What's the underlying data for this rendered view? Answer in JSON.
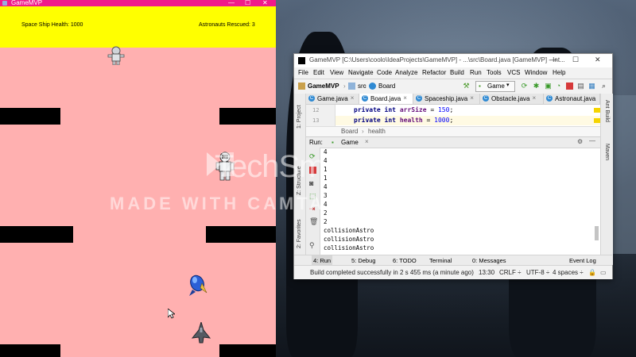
{
  "game_window": {
    "title": "GameMVP",
    "controls": {
      "minimize": "—",
      "maximize": "☐",
      "close": "✕"
    },
    "hud": {
      "health_text": "Space Ship Health: 1000",
      "rescued_text": "Astronauts Rescued: 3"
    },
    "colors": {
      "titlebar": "#f01a8a",
      "hud": "#ffff00",
      "background": "#ffb0b0"
    }
  },
  "ide": {
    "title": "GameMVP [C:\\Users\\coolo\\IdeaProjects\\GameMVP] - ...\\src\\Board.java [GameMVP] - Int...",
    "window_controls": {
      "minimize": "—",
      "maximize": "☐",
      "close": "✕"
    },
    "menu": [
      "File",
      "Edit",
      "View",
      "Navigate",
      "Code",
      "Analyze",
      "Refactor",
      "Build",
      "Run",
      "Tools",
      "VCS",
      "Window",
      "Help"
    ],
    "breadcrumb": {
      "project": "GameMVP",
      "folder": "src",
      "file": "Board"
    },
    "run_config": "Game",
    "left_tool_labels": {
      "project": "1: Project",
      "structure": "Z: Structure",
      "favorites": "2: Favorites"
    },
    "right_tool_labels": {
      "ant": "Ant Build",
      "maven": "Maven"
    },
    "editor_tabs": [
      {
        "label": "Game.java",
        "active": false
      },
      {
        "label": "Board.java",
        "active": true
      },
      {
        "label": "Spaceship.java",
        "active": false
      },
      {
        "label": "Obstacle.java",
        "active": false
      },
      {
        "label": "Astronaut.java",
        "active": false
      }
    ],
    "code_lines": [
      {
        "num": "12",
        "kw": "private int",
        "name": "arrSize",
        "eq": " = ",
        "val": "150",
        "end": ";"
      },
      {
        "num": "13",
        "kw": "private int",
        "name": "health",
        "eq": " = ",
        "val": "1000",
        "end": ";"
      }
    ],
    "structure_crumb": {
      "cls": "Board",
      "member": "health"
    },
    "run_panel": {
      "label": "Run:",
      "tab": "Game",
      "output": [
        "4",
        "4",
        "1",
        "1",
        "4",
        "3",
        "4",
        "2",
        "2",
        "collisionAstro",
        "collisionAstro",
        "collisionAstro"
      ]
    },
    "bottom_tabs": [
      {
        "label": "4: Run",
        "active": true
      },
      {
        "label": "5: Debug",
        "active": false
      },
      {
        "label": "6: TODO",
        "active": false
      },
      {
        "label": "Terminal",
        "active": false
      },
      {
        "label": "0: Messages",
        "active": false
      }
    ],
    "event_log": "Event Log",
    "status": {
      "message": "Build completed successfully in 2 s 455 ms (a minute ago)",
      "position": "13:30",
      "line_sep": "CRLF ÷",
      "encoding": "UTF-8 ÷",
      "indent": "4 spaces ÷"
    }
  },
  "watermark": {
    "brand": "TechSmith",
    "tagline": "MADE WITH CAMTASIA FREE TRIAL"
  }
}
